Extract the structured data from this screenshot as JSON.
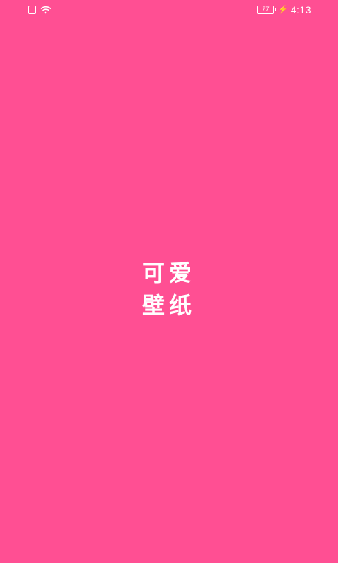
{
  "status_bar": {
    "battery_level": "77",
    "time": "4:13",
    "icons": [
      "sim-icon",
      "wifi-icon",
      "battery-icon",
      "charging-icon"
    ]
  },
  "splash": {
    "title_line1": "可爱",
    "title_line2": "壁纸"
  },
  "colors": {
    "background": "#FF4F93",
    "foreground": "#FFFFFF"
  }
}
